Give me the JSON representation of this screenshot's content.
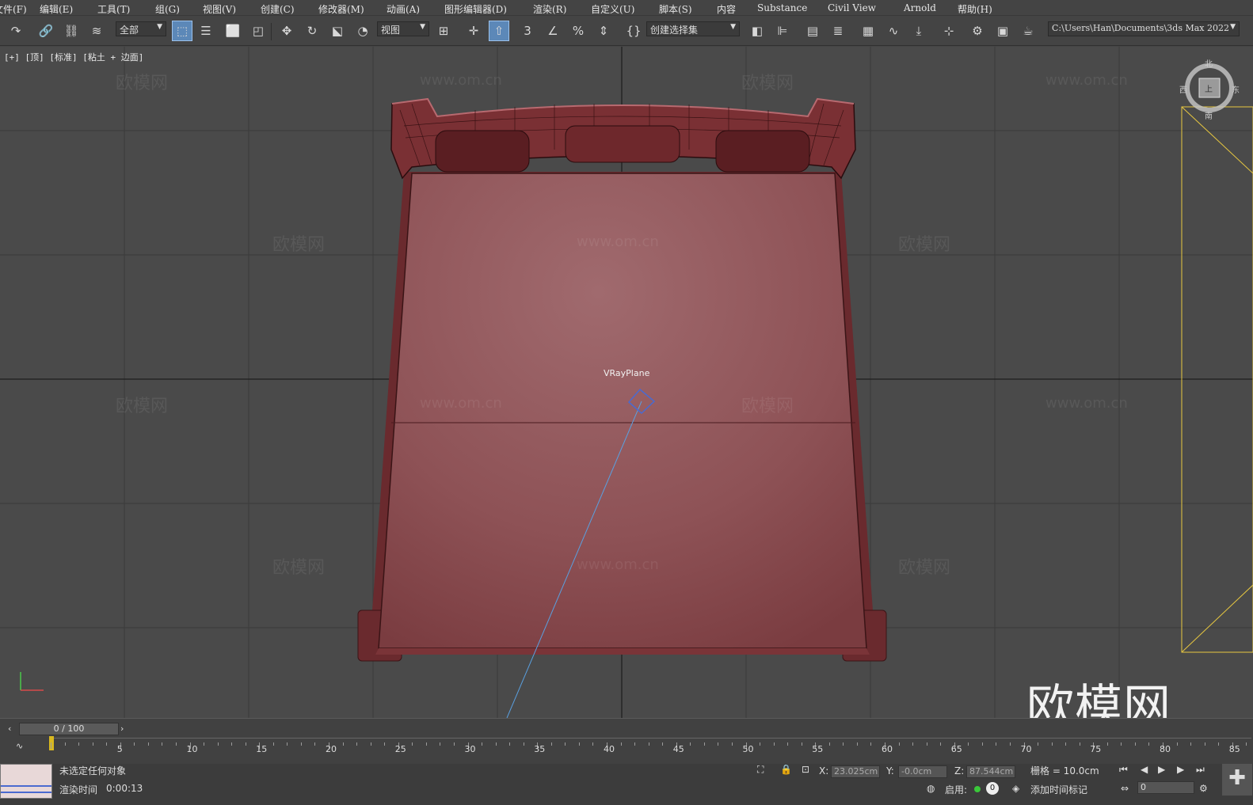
{
  "menu": [
    "文件(F)",
    "编辑(E)",
    "工具(T)",
    "组(G)",
    "视图(V)",
    "创建(C)",
    "修改器(M)",
    "动画(A)",
    "图形编辑器(D)",
    "渲染(R)",
    "自定义(U)",
    "脚本(S)",
    "内容",
    "Substance",
    "Civil View",
    "Arnold",
    "帮助(H)"
  ],
  "toolbar": {
    "filter_value": "全部",
    "coord_value": "视图",
    "named_selection_placeholder": "创建选择集",
    "project_path": "C:\\Users\\Han\\Documents\\3ds Max 2022"
  },
  "viewport": {
    "label": "[+] [顶] [标准] [粘土 + 边面]",
    "object_label": "VRayPlane",
    "watermark_text": "欧模网",
    "watermark_url": "www.om.cn",
    "big_watermark": "欧模网",
    "viewcube_label": "上",
    "compass": {
      "n": "北",
      "s": "南",
      "w": "西",
      "e": "东"
    }
  },
  "timeline": {
    "frame_display": "0 / 100",
    "ticks": [
      "5",
      "10",
      "15",
      "20",
      "25",
      "30",
      "35",
      "40",
      "45",
      "50",
      "55",
      "60",
      "65",
      "70",
      "75",
      "80",
      "85"
    ]
  },
  "status": {
    "selection": "未选定任何对象",
    "render_time_label": "渲染时间",
    "render_time_value": "0:00:13",
    "x_label": "X:",
    "x_value": "23.025cm",
    "y_label": "Y:",
    "y_value": "-0.0cm",
    "z_label": "Z:",
    "z_value": "87.544cm",
    "grid": "栅格 = 10.0cm",
    "enable_label": "启用:",
    "enable_count": "0",
    "add_time_tag": "添加时间标记",
    "frame_input": "0"
  },
  "colors": {
    "object": "#8a4a4e",
    "accent": "#5c88b8",
    "selection_box": "#e8c840",
    "link_line": "#5aa0e0"
  }
}
